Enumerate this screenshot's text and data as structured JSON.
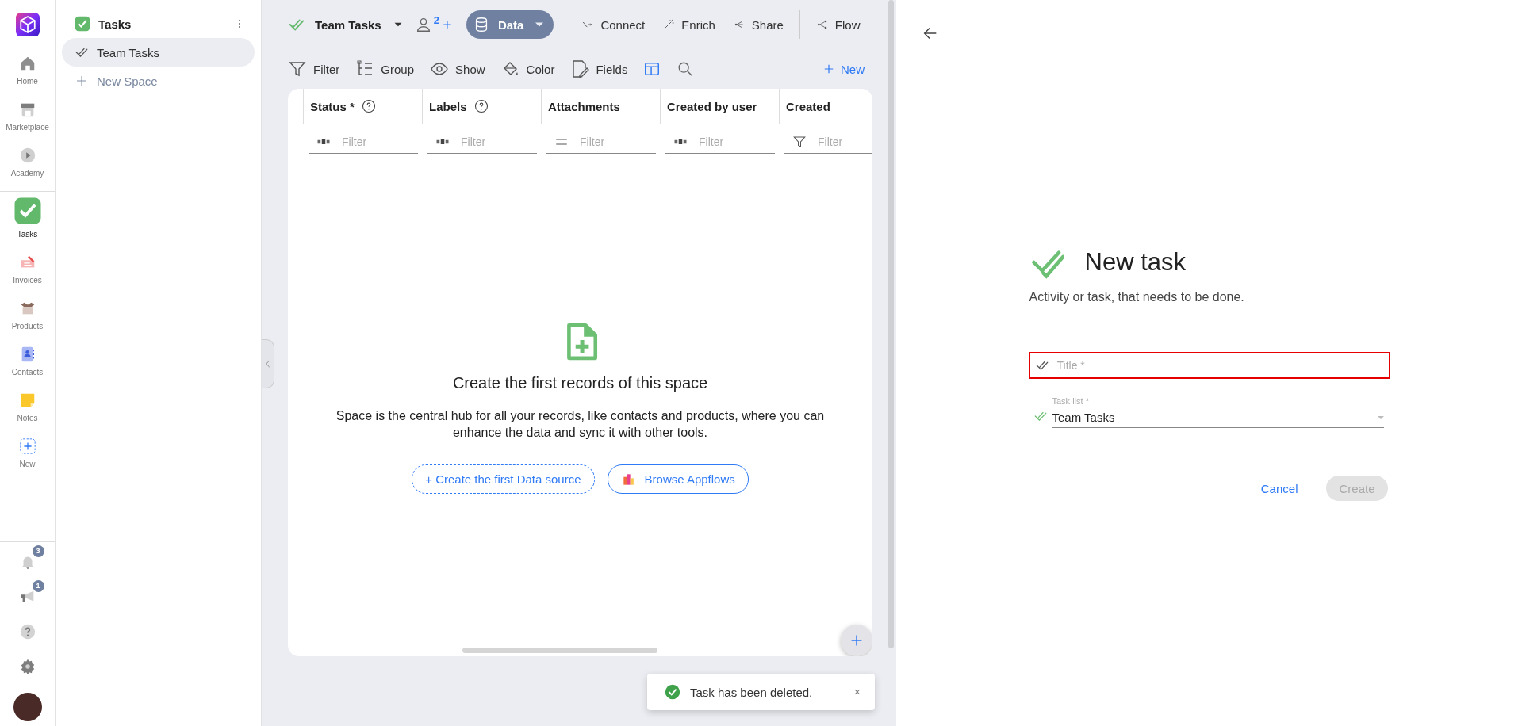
{
  "rail": {
    "items": [
      {
        "kind": "home",
        "label": "Home",
        "selected": false
      },
      {
        "kind": "store",
        "label": "Marketplace",
        "selected": false
      },
      {
        "kind": "play",
        "label": "Academy",
        "selected": false
      },
      {
        "kind": "tasks",
        "label": "Tasks",
        "selected": true
      },
      {
        "kind": "invoice",
        "label": "Invoices",
        "selected": false
      },
      {
        "kind": "box",
        "label": "Products",
        "selected": false
      },
      {
        "kind": "contact",
        "label": "Contacts",
        "selected": false
      },
      {
        "kind": "note",
        "label": "Notes",
        "selected": false
      },
      {
        "kind": "new",
        "label": "New",
        "selected": false
      }
    ],
    "bottom": [
      {
        "kind": "bell",
        "badge": "3"
      },
      {
        "kind": "megaphone",
        "badge": "1"
      },
      {
        "kind": "help"
      },
      {
        "kind": "gear"
      },
      {
        "kind": "avatar"
      }
    ]
  },
  "sidebar": {
    "title": "Tasks",
    "items": [
      {
        "label": "Team Tasks",
        "selected": true
      }
    ],
    "new_space": "New Space"
  },
  "toolbar": {
    "space": "Team Tasks",
    "members": "2",
    "data_button": "Data",
    "actions": [
      {
        "kind": "connect",
        "label": "Connect"
      },
      {
        "kind": "enrich",
        "label": "Enrich"
      },
      {
        "kind": "share",
        "label": "Share"
      },
      {
        "kind": "flow",
        "label": "Flow"
      }
    ]
  },
  "view_bar": {
    "actions": [
      {
        "kind": "filter",
        "label": "Filter"
      },
      {
        "kind": "group",
        "label": "Group"
      },
      {
        "kind": "show",
        "label": "Show"
      },
      {
        "kind": "color",
        "label": "Color"
      },
      {
        "kind": "fields",
        "label": "Fields"
      }
    ],
    "new": "New"
  },
  "table": {
    "columns": [
      {
        "label": "Status *",
        "help": true,
        "filter": {
          "kind": "text",
          "placeholder": "Filter"
        }
      },
      {
        "label": "Labels",
        "help": true,
        "filter": {
          "kind": "text",
          "placeholder": "Filter"
        }
      },
      {
        "label": "Attachments",
        "help": false,
        "filter": {
          "kind": "equals",
          "placeholder": "Filter"
        }
      },
      {
        "label": "Created by user",
        "help": false,
        "filter": {
          "kind": "text",
          "placeholder": "Filter"
        }
      },
      {
        "label": "Created",
        "help": false,
        "filter": {
          "kind": "funnel",
          "placeholder": "Filter"
        }
      }
    ]
  },
  "empty_state": {
    "title": "Create the first records of this space",
    "text": "Space is the central hub for all your records, like contacts and products, where you can enhance the data and sync it with other tools.",
    "buttons": [
      {
        "kind": "dashed",
        "label": "+ Create the first Data source"
      },
      {
        "kind": "appflows",
        "label": "Browse Appflows"
      }
    ]
  },
  "toast": {
    "text": "Task has been deleted.",
    "close": "×"
  },
  "panel": {
    "title": "New task",
    "subtitle": "Activity or task, that needs to be done.",
    "title_field": {
      "placeholder": "Title *",
      "error": true
    },
    "task_list": {
      "label": "Task list *",
      "value": "Team Tasks"
    },
    "cancel": "Cancel",
    "create": {
      "label": "Create",
      "disabled": true
    }
  }
}
